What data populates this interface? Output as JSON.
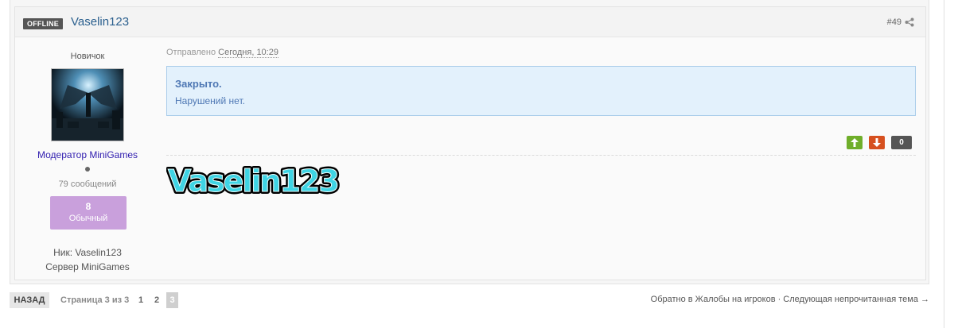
{
  "post": {
    "status_badge": "OFFLINE",
    "author": "Vaselin123",
    "number": "#49",
    "rank": "Новичок",
    "group": "Модератор MiniGames",
    "post_count": "79 сообщений",
    "reputation": {
      "value": "8",
      "label": "Обычный",
      "color": "#c9a0dc"
    },
    "nick_line": "Ник: Vaselin123",
    "server_line": "Сервер MiniGames",
    "sent_label": "Отправлено",
    "sent_date": "Сегодня, 10:29",
    "notice_title": "Закрыто.",
    "notice_text": "Нарушений нет.",
    "votes": {
      "count": "0",
      "up_icon": "arrow-up-icon",
      "down_icon": "arrow-down-icon"
    },
    "signature": "Vaselin123"
  },
  "pagination": {
    "back_label": "НАЗАД",
    "info": "Страница 3 из 3",
    "pages": [
      "1",
      "2"
    ],
    "current": "3"
  },
  "nav": {
    "back_to_forum": "Обратно в Жалобы на игроков · Следующая непрочитанная тема →"
  },
  "colors": {
    "link": "#2a5f8e",
    "group": "#3320b0",
    "notice_bg": "#e3f1fc",
    "notice_border": "#a9ccea",
    "vote_up": "#6fae2a",
    "vote_down": "#d6501f"
  }
}
